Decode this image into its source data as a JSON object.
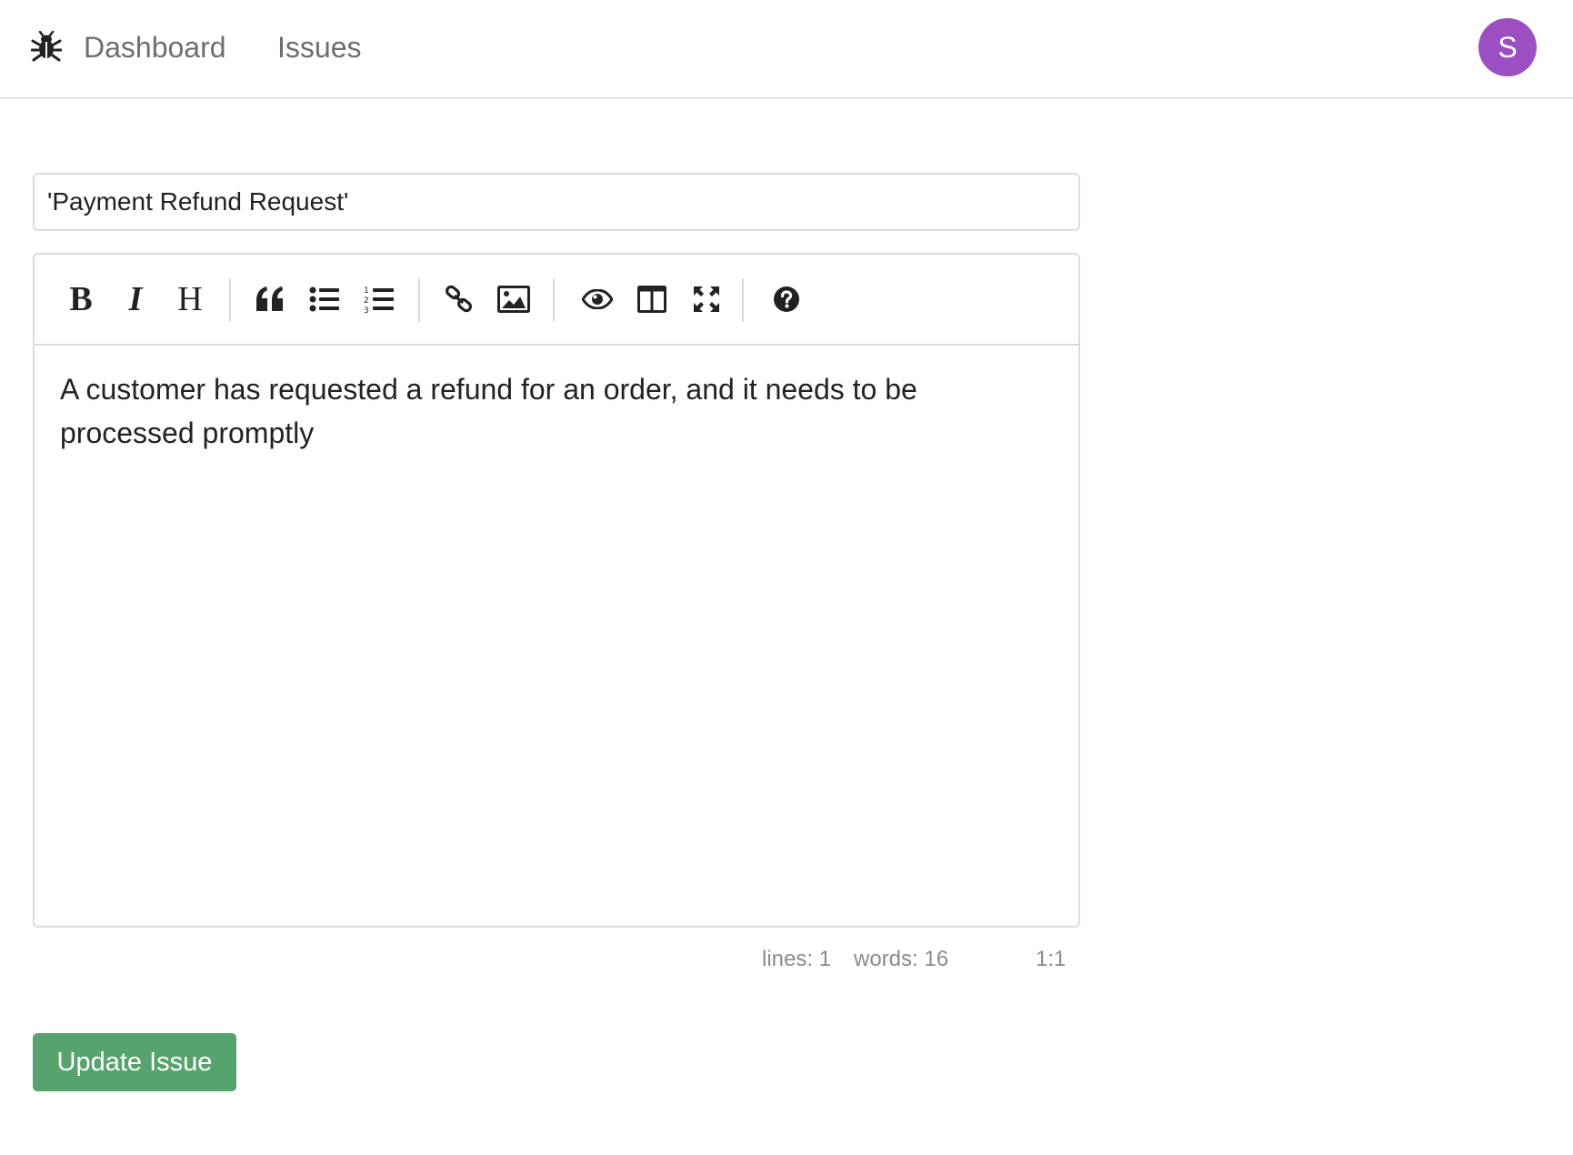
{
  "nav": {
    "logo_icon": "bug-icon",
    "links": [
      {
        "label": "Dashboard"
      },
      {
        "label": "Issues"
      }
    ],
    "avatar_initial": "S",
    "avatar_color": "#9b4fc2"
  },
  "form": {
    "title_value": "'Payment Refund Request'",
    "editor": {
      "toolbar": [
        {
          "icon": "bold-icon"
        },
        {
          "icon": "italic-icon"
        },
        {
          "icon": "heading-icon"
        },
        {
          "icon": "quote-icon"
        },
        {
          "icon": "unordered-list-icon"
        },
        {
          "icon": "ordered-list-icon"
        },
        {
          "icon": "link-icon"
        },
        {
          "icon": "image-icon"
        },
        {
          "icon": "preview-eye-icon"
        },
        {
          "icon": "side-by-side-icon"
        },
        {
          "icon": "fullscreen-icon"
        },
        {
          "icon": "help-icon"
        }
      ],
      "content": "A customer has requested a refund for an order, and it needs to be processed promptly"
    },
    "status": {
      "lines": "lines: 1",
      "words": "words: 16",
      "cursor": "1:1"
    },
    "submit_label": "Update Issue",
    "submit_color": "#57a36d"
  }
}
